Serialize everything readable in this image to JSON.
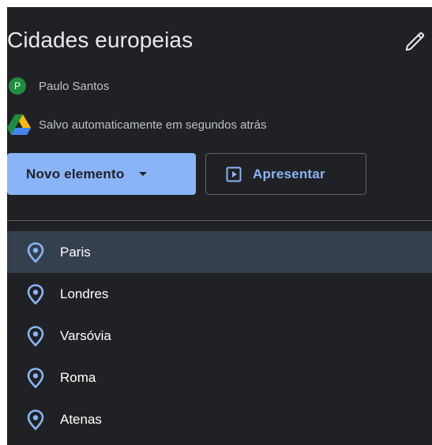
{
  "map": {
    "title": "Cidades europeias",
    "owner_initial": "P",
    "owner_name": "Paulo Santos",
    "save_status": "Salvo automaticamente em segundos atrás"
  },
  "buttons": {
    "new_item_label": "Novo elemento",
    "present_label": "Apresentar"
  },
  "places": [
    {
      "label": "Paris",
      "selected": true
    },
    {
      "label": "Londres",
      "selected": false
    },
    {
      "label": "Varsóvia",
      "selected": false
    },
    {
      "label": "Roma",
      "selected": false
    },
    {
      "label": "Atenas",
      "selected": false
    }
  ],
  "icons": {
    "edit": "pencil-icon",
    "drive": "google-drive-icon",
    "present": "present-icon",
    "caret": "caret-down-icon",
    "place": "location-pin-icon"
  },
  "colors": {
    "panel_background": "#202124",
    "accent": "#8ab4f8",
    "avatar": "#1e8e3e",
    "selected_row": "#35404f",
    "primary_text": "#e8eaed",
    "secondary_text": "#bdc1c6"
  }
}
